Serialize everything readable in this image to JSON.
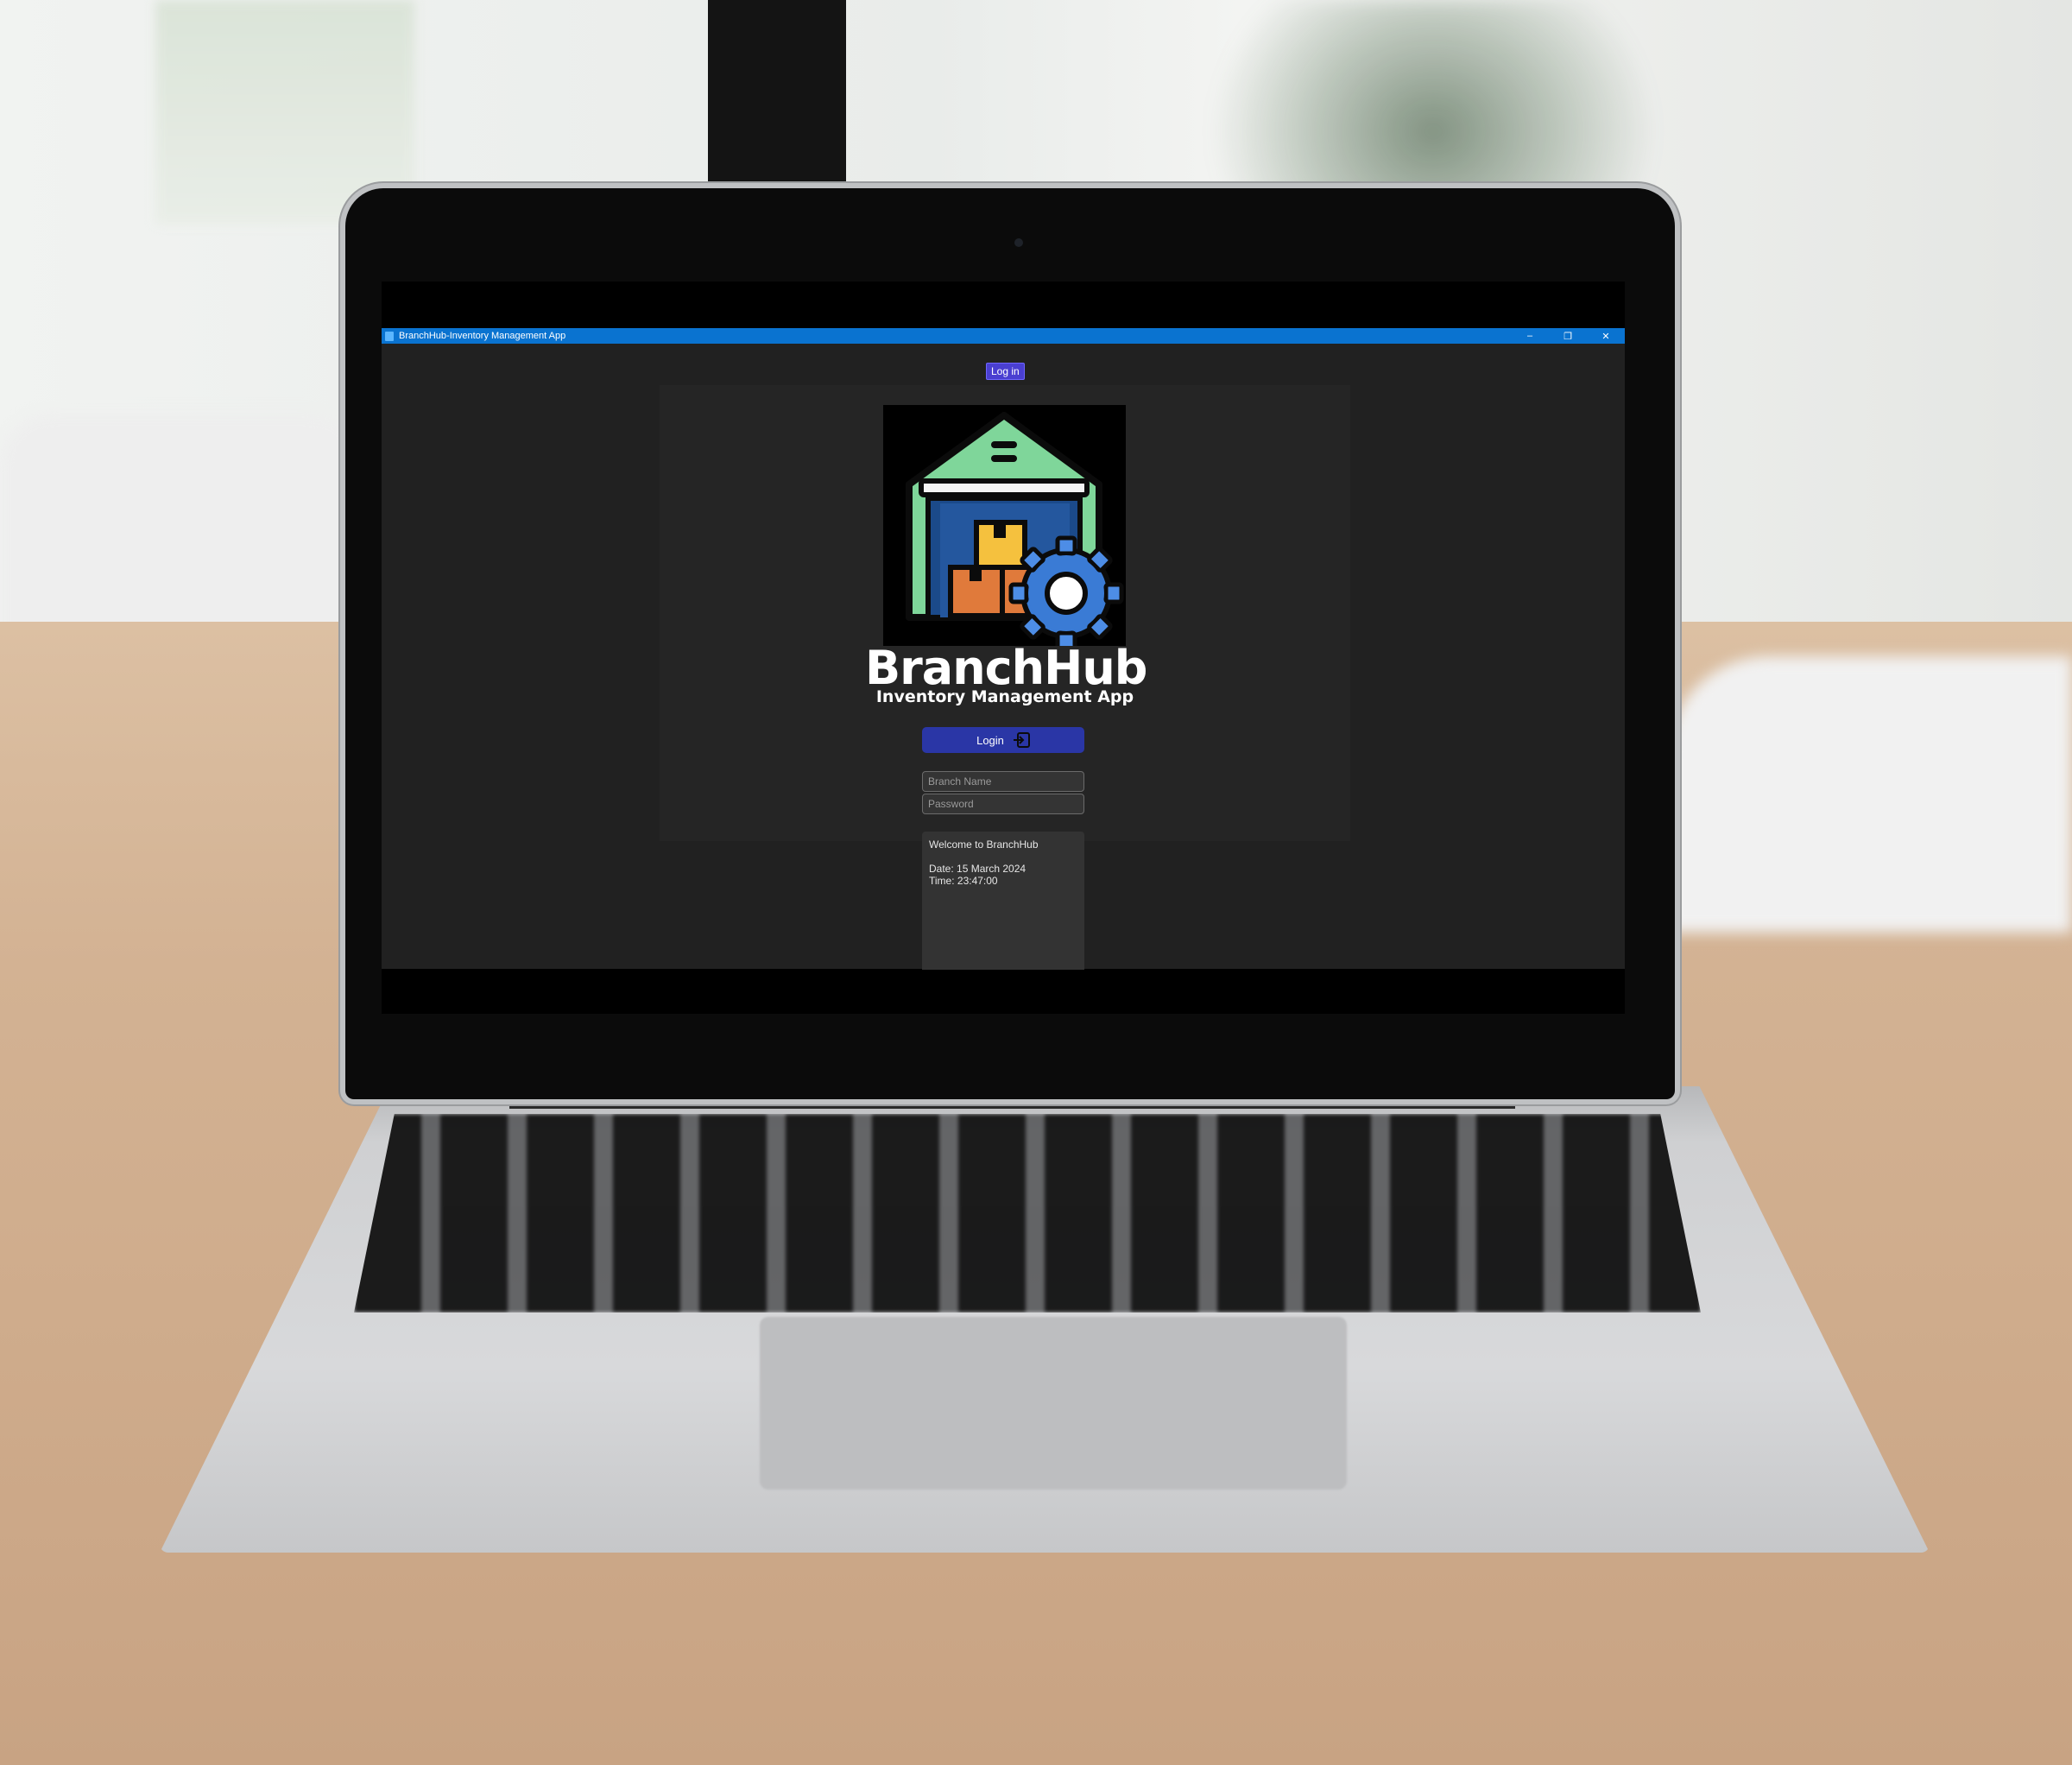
{
  "window": {
    "title": "BranchHub-Inventory Management App",
    "controls": {
      "minimize": "–",
      "maximize": "❐",
      "close": "✕"
    }
  },
  "tabs": {
    "active_label": "Log in"
  },
  "brand": {
    "name": "BranchHub",
    "tagline": "Inventory Management App"
  },
  "login": {
    "button_label": "Login",
    "branch_placeholder": "Branch Name",
    "password_placeholder": "Password"
  },
  "info_box": {
    "welcome": "Welcome to BranchHub",
    "date": "Date: 15 March 2024",
    "time": "Time: 23:47:00"
  },
  "colors": {
    "titlebar": "#0a73d0",
    "window_bg": "#212121",
    "login_button": "#2a36a6",
    "tab_active": "#4a3fd1"
  },
  "icons": {
    "app": "app-icon",
    "login": "sign-in-icon",
    "logo": "warehouse-gear-icon"
  }
}
